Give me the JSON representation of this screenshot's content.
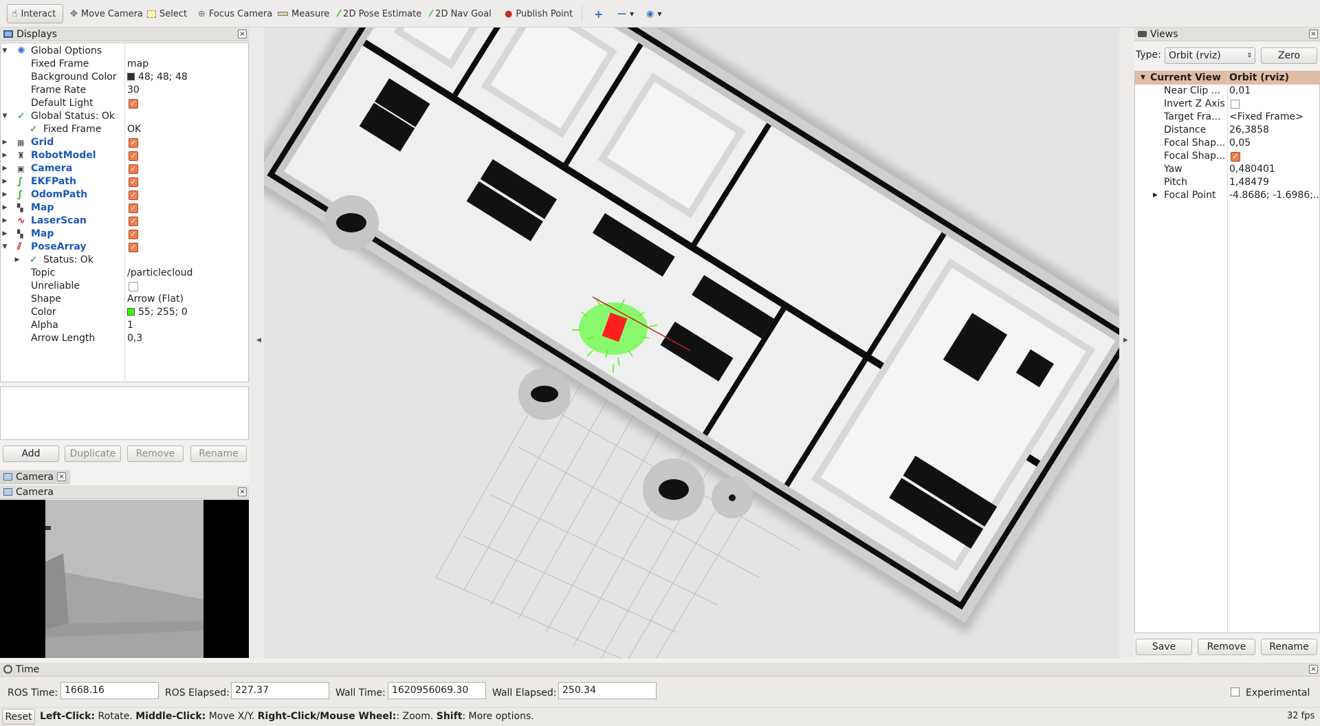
{
  "toolbar": {
    "interact": "Interact",
    "move_camera": "Move Camera",
    "select": "Select",
    "focus_camera": "Focus Camera",
    "measure": "Measure",
    "pose_estimate": "2D Pose Estimate",
    "nav_goal": "2D Nav Goal",
    "publish_point": "Publish Point"
  },
  "displays": {
    "title": "Displays",
    "rows": [
      {
        "name": "Global Options",
        "value": ""
      },
      {
        "name": "Fixed Frame",
        "value": "map"
      },
      {
        "name": "Background Color",
        "value": "48; 48; 48"
      },
      {
        "name": "Frame Rate",
        "value": "30"
      },
      {
        "name": "Default Light",
        "value": ""
      },
      {
        "name": "Global Status: Ok",
        "value": ""
      },
      {
        "name": "Fixed Frame",
        "value": "OK"
      },
      {
        "name": "Grid",
        "value": ""
      },
      {
        "name": "RobotModel",
        "value": ""
      },
      {
        "name": "Camera",
        "value": ""
      },
      {
        "name": "EKFPath",
        "value": ""
      },
      {
        "name": "OdomPath",
        "value": ""
      },
      {
        "name": "Map",
        "value": ""
      },
      {
        "name": "LaserScan",
        "value": ""
      },
      {
        "name": "Map",
        "value": ""
      },
      {
        "name": "PoseArray",
        "value": ""
      },
      {
        "name": "Status: Ok",
        "value": ""
      },
      {
        "name": "Topic",
        "value": "/particlecloud"
      },
      {
        "name": "Unreliable",
        "value": ""
      },
      {
        "name": "Shape",
        "value": "Arrow (Flat)"
      },
      {
        "name": "Color",
        "value": "55; 255; 0"
      },
      {
        "name": "Alpha",
        "value": "1"
      },
      {
        "name": "Arrow Length",
        "value": "0,3"
      }
    ],
    "buttons": {
      "add": "Add",
      "duplicate": "Duplicate",
      "remove": "Remove",
      "rename": "Rename"
    }
  },
  "camera": {
    "tab": "Camera",
    "title": "Camera"
  },
  "views": {
    "title": "Views",
    "type_label": "Type:",
    "type_value": "Orbit (rviz)",
    "zero": "Zero",
    "header_key": "Current View",
    "header_value": "Orbit (rviz)",
    "rows": [
      {
        "k": "Near Clip ...",
        "v": "0,01"
      },
      {
        "k": "Invert Z Axis",
        "v": ""
      },
      {
        "k": "Target Fra...",
        "v": "<Fixed Frame>"
      },
      {
        "k": "Distance",
        "v": "26,3858"
      },
      {
        "k": "Focal Shap...",
        "v": "0,05"
      },
      {
        "k": "Focal Shap...",
        "v": ""
      },
      {
        "k": "Yaw",
        "v": "0,480401"
      },
      {
        "k": "Pitch",
        "v": "1,48479"
      },
      {
        "k": "Focal Point",
        "v": "-4.8686; -1.6986;..."
      }
    ],
    "buttons": {
      "save": "Save",
      "remove": "Remove",
      "rename": "Rename"
    }
  },
  "time": {
    "title": "Time",
    "ros_time_label": "ROS Time:",
    "ros_time": "1668.16",
    "ros_elapsed_label": "ROS Elapsed:",
    "ros_elapsed": "227.37",
    "wall_time_label": "Wall Time:",
    "wall_time": "1620956069.30",
    "wall_elapsed_label": "Wall Elapsed:",
    "wall_elapsed": "250.34",
    "experimental": "Experimental"
  },
  "status": {
    "reset": "Reset",
    "left_click": "Left-Click:",
    "left_desc": " Rotate. ",
    "middle_click": "Middle-Click:",
    "middle_desc": " Move X/Y. ",
    "right_click": "Right-Click/Mouse Wheel:",
    "right_desc": ": Zoom. ",
    "shift": "Shift",
    "shift_desc": ": More options.",
    "fps": "32 fps"
  },
  "colors": {
    "background": "#303030",
    "pose_array": "#37ff00",
    "robot": "#ff2020",
    "checkbox": "#f07f4e"
  }
}
